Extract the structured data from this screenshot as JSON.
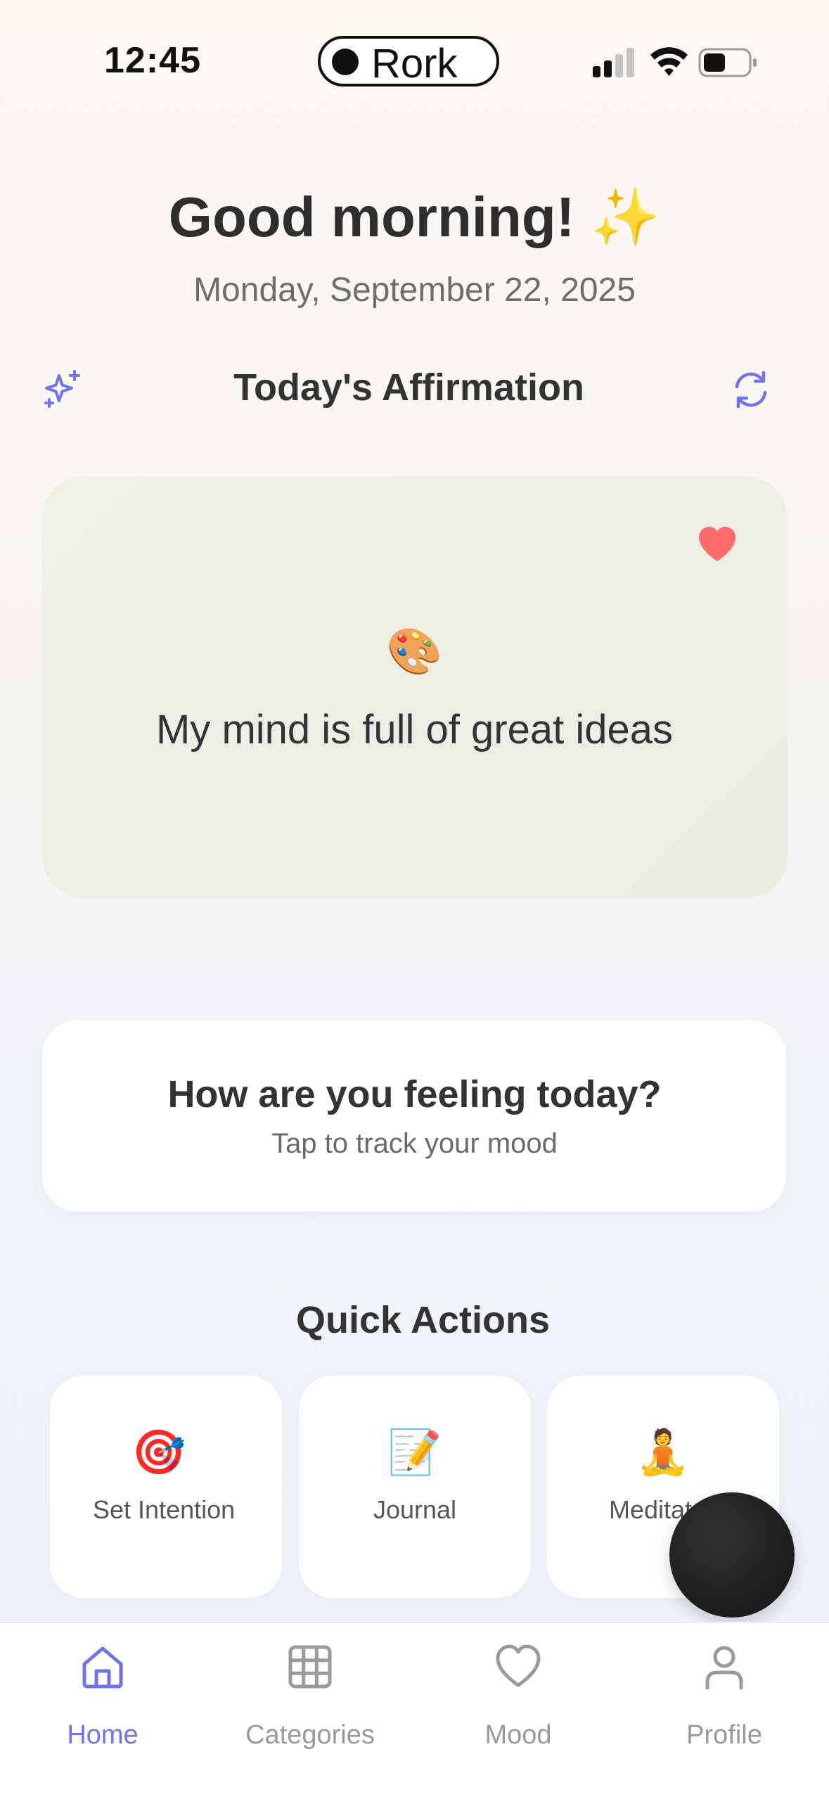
{
  "status_bar": {
    "time": "12:45",
    "island_label": "Rork",
    "icons": [
      "cellular-signal-icon",
      "wifi-icon",
      "battery-icon"
    ]
  },
  "greeting": {
    "title": "Good morning! ✨",
    "date": "Monday, September 22, 2025"
  },
  "affirmation": {
    "header": "Today's Affirmation",
    "emoji": "🎨",
    "text": "My mind is full of great ideas",
    "favorited": true,
    "icons": {
      "left": "sparkles-icon",
      "right": "refresh-icon",
      "favorite": "heart-icon"
    }
  },
  "mood": {
    "title": "How are you feeling today?",
    "subtitle": "Tap to track your mood"
  },
  "quick_actions": {
    "title": "Quick Actions",
    "items": [
      {
        "emoji": "🎯",
        "label": "Set Intention"
      },
      {
        "emoji": "📝",
        "label": "Journal"
      },
      {
        "emoji": "🧘",
        "label": "Meditate"
      }
    ]
  },
  "tab_bar": {
    "items": [
      {
        "label": "Home",
        "icon": "home-icon",
        "active": true
      },
      {
        "label": "Categories",
        "icon": "grid-icon",
        "active": false
      },
      {
        "label": "Mood",
        "icon": "heart-icon",
        "active": false
      },
      {
        "label": "Profile",
        "icon": "person-icon",
        "active": false
      }
    ]
  },
  "colors": {
    "accent": "#6f75e8",
    "heart": "#ff6b6b",
    "inactive_tab": "#9a9a9a",
    "affirmation_card": "#eceee4"
  }
}
